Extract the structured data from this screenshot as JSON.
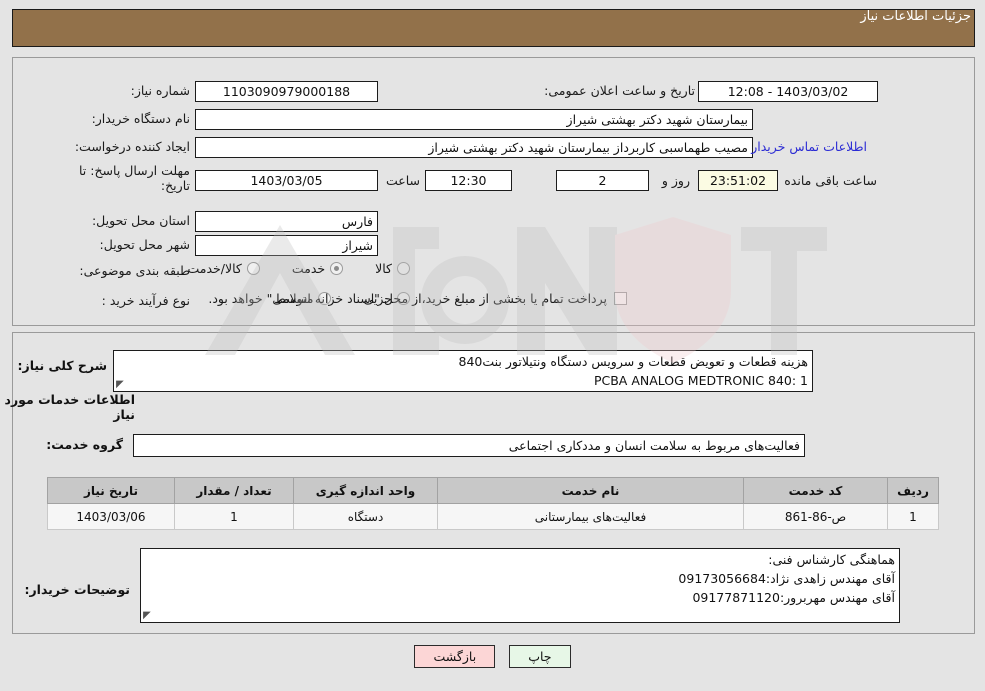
{
  "header": {
    "title": "جزئیات اطلاعات نیاز"
  },
  "form": {
    "need_number_label": "شماره نیاز:",
    "need_number_value": "1103090979000188",
    "announce_datetime_label": "تاریخ و ساعت اعلان عمومی:",
    "announce_datetime_value": "1403/03/02 - 12:08",
    "buyer_org_label": "نام دستگاه خریدار:",
    "buyer_org_value": "بیمارستان شهید دکتر بهشتی شیراز",
    "requester_label": "ایجاد کننده درخواست:",
    "requester_value": "مصیب طهماسبی کاربرداز بیمارستان شهید دکتر بهشتی شیراز",
    "buyer_contact_link": "اطلاعات تماس خریدار",
    "deadline_label_line1": "مهلت ارسال پاسخ: تا",
    "deadline_label_line2": "تاریخ:",
    "deadline_date": "1403/03/05",
    "hour_label": "ساعت",
    "deadline_time": "12:30",
    "days_value": "2",
    "days_label": "روز و",
    "countdown_value": "23:51:02",
    "countdown_label": "ساعت باقی مانده",
    "province_label": "استان محل تحویل:",
    "province_value": "فارس",
    "city_label": "شهر محل تحویل:",
    "city_value": "شیراز",
    "category_label": "طبقه بندی موضوعی:",
    "category_options": [
      {
        "label": "کالا",
        "selected": false
      },
      {
        "label": "خدمت",
        "selected": true
      },
      {
        "label": "کالا/خدمت",
        "selected": false
      }
    ],
    "process_label": "نوع فرآیند خرید :",
    "process_options": [
      {
        "label": "جزیی",
        "selected": false
      },
      {
        "label": "متوسط",
        "selected": false
      }
    ],
    "treasury_checkbox_checked": false,
    "treasury_text": "پرداخت تمام یا بخشی از مبلغ خرید،از محل \"اسناد خزانه اسلامی\" خواهد بود."
  },
  "details": {
    "summary_label": "شرح کلی نیاز:",
    "summary_line1": "هزینه قطعات و تعویض قطعات و سرویس دستگاه ونتیلاتور بنت840",
    "summary_line2": "PCBA ANALOG MEDTRONIC 840: 1",
    "services_section_title": "اطلاعات خدمات مورد نیاز",
    "service_group_label": "گروه خدمت:",
    "service_group_value": "فعالیت‌های مربوط به سلامت انسان و مددکاری اجتماعی",
    "buyer_notes_label": "توضیحات خریدار:",
    "buyer_notes_line1": "هماهنگی کارشناس فنی:",
    "buyer_notes_line2": "آقای مهندس زاهدی نژاد:09173056684",
    "buyer_notes_line3": "آقای مهندس مهربرور:09177871120"
  },
  "table": {
    "headers": [
      "ردیف",
      "کد خدمت",
      "نام خدمت",
      "واحد اندازه گیری",
      "تعداد / مقدار",
      "تاریخ نیاز"
    ],
    "rows": [
      {
        "index": "1",
        "service_code": "ص-86-861",
        "service_name": "فعالیت‌های بیمارستانی",
        "unit": "دستگاه",
        "quantity": "1",
        "need_date": "1403/03/06"
      }
    ]
  },
  "buttons": {
    "print": "چاپ",
    "back": "بازگشت"
  },
  "colors": {
    "header_bg": "#92714a",
    "link": "#2b2bd4",
    "countdown_bg": "#fbfbe3",
    "print_bg": "#e7f7e7",
    "back_bg": "#fcd6d6"
  },
  "watermark_text": "AnaTender.net"
}
